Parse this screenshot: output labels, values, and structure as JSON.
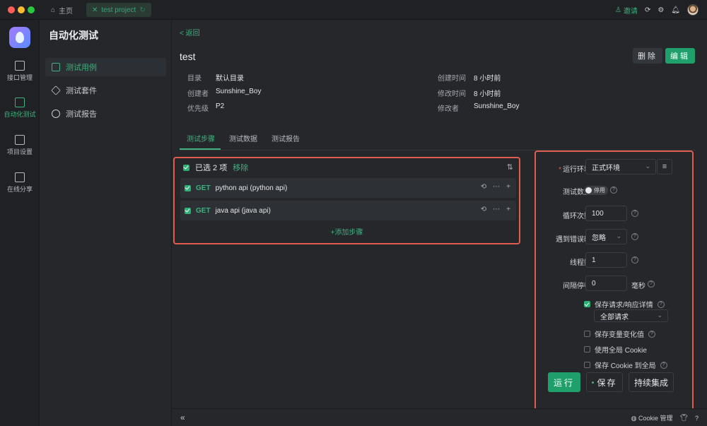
{
  "titlebar": {
    "tabs": [
      {
        "label": "主页",
        "icon": "home-icon"
      },
      {
        "label": "test project",
        "icon": "close-icon"
      }
    ],
    "invite_label": "邀请"
  },
  "rail": {
    "items": [
      {
        "label": "接口管理",
        "icon": "api-icon"
      },
      {
        "label": "自动化测试",
        "icon": "automation-icon"
      },
      {
        "label": "项目设置",
        "icon": "settings-icon"
      },
      {
        "label": "在线分享",
        "icon": "share-icon"
      }
    ],
    "active": "自动化测试"
  },
  "sidebar": {
    "title": "自动化测试",
    "items": [
      {
        "label": "测试用例",
        "icon": "document-icon"
      },
      {
        "label": "测试套件",
        "icon": "suite-icon"
      },
      {
        "label": "测试报告",
        "icon": "pie-chart-icon"
      }
    ]
  },
  "main": {
    "back_label": "< 返回",
    "title": "test",
    "delete_label": "删除",
    "edit_label": "编辑",
    "meta_left": [
      {
        "key": "目录",
        "value": "默认目录"
      },
      {
        "key": "创建者",
        "value": "Sunshine_Boy"
      },
      {
        "key": "优先级",
        "value": "P2"
      }
    ],
    "meta_right": [
      {
        "key": "创建时间",
        "value": "8 小时前"
      },
      {
        "key": "修改时间",
        "value": "8 小时前"
      },
      {
        "key": "修改者",
        "value": "Sunshine_Boy"
      }
    ],
    "tabs": [
      "测试步骤",
      "测试数据",
      "测试报告"
    ],
    "active_tab": "测试步骤"
  },
  "steps": {
    "selected_text": "已选 2 项",
    "remove_label": "移除",
    "items": [
      {
        "method": "GET",
        "name": "python api (python api)"
      },
      {
        "method": "GET",
        "name": "java api (java api)"
      }
    ],
    "add_label": "+添加步骤"
  },
  "run_panel": {
    "env_label": "运行环境",
    "env_value": "正式环境",
    "test_data_label": "测试数据",
    "test_data_toggle": "停用",
    "loop_label": "循环次数",
    "loop_value": "100",
    "on_error_label": "遇到错误时",
    "on_error_value": "忽略",
    "threads_label": "线程数",
    "threads_value": "1",
    "interval_label": "间隔停顿",
    "interval_value": "0",
    "interval_unit": "毫秒",
    "save_detail_label": "保存请求/响应详情",
    "save_detail_checked": true,
    "save_detail_option": "全部请求",
    "save_var_label": "保存变量变化值",
    "global_cookie_label": "使用全局 Cookie",
    "save_cookie_label": "保存 Cookie 到全局",
    "run_label": "运行",
    "save_label": "保存",
    "ci_label": "持续集成"
  },
  "bottombar": {
    "cookie_label": "Cookie 管理"
  },
  "colors": {
    "accent": "#3fb07f",
    "primary_button": "#1f9f69",
    "highlight_border": "#e05b50"
  }
}
